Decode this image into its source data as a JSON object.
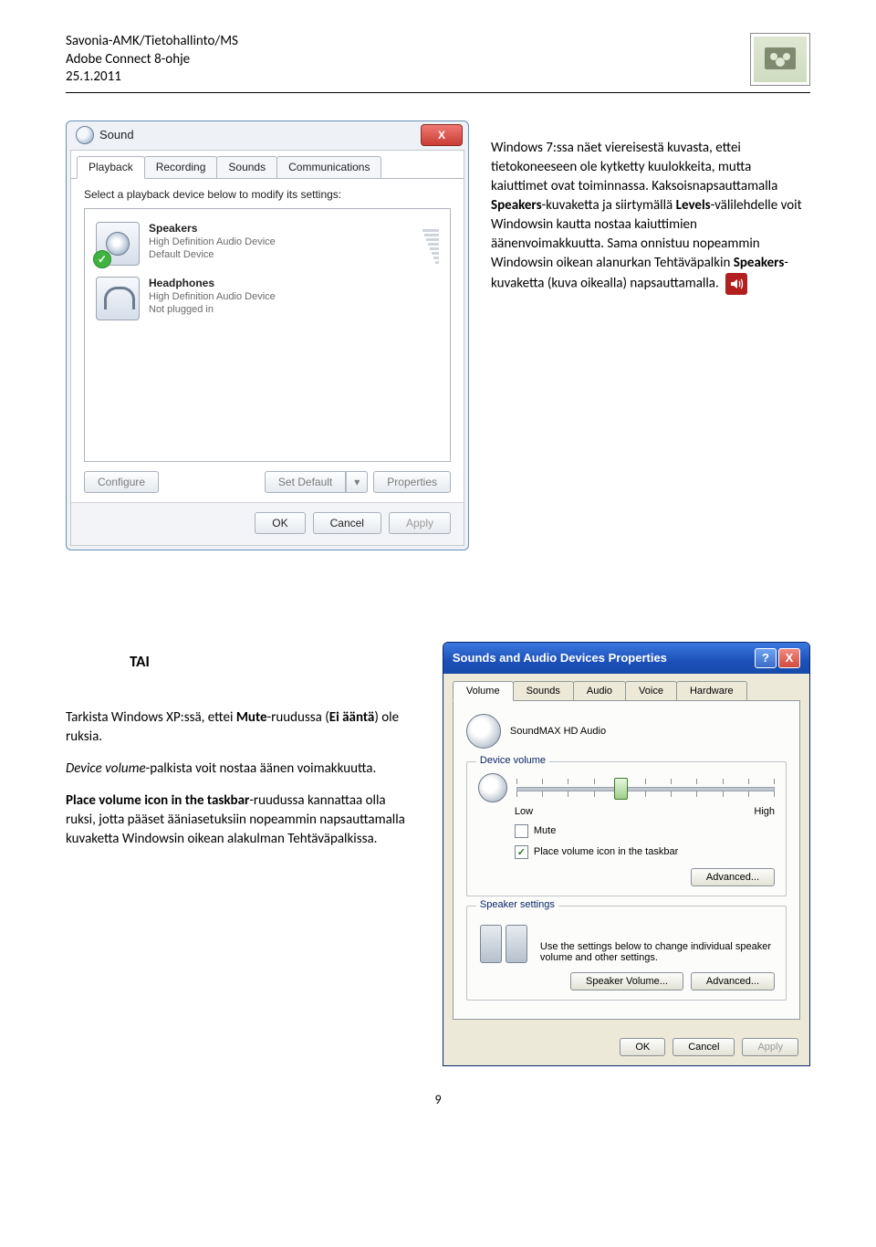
{
  "header": {
    "line1": "Savonia-AMK/Tietohallinto/MS",
    "line2": "Adobe Connect 8-ohje",
    "line3": "25.1.2011"
  },
  "win7": {
    "title": "Sound",
    "close": "X",
    "tabs": [
      "Playback",
      "Recording",
      "Sounds",
      "Communications"
    ],
    "prompt": "Select a playback device below to modify its settings:",
    "dev1": {
      "name": "Speakers",
      "l1": "High Definition Audio Device",
      "l2": "Default Device"
    },
    "dev2": {
      "name": "Headphones",
      "l1": "High Definition Audio Device",
      "l2": "Not plugged in"
    },
    "configure": "Configure",
    "setdefault": "Set Default",
    "properties": "Properties",
    "ok": "OK",
    "cancel": "Cancel",
    "apply": "Apply"
  },
  "side": {
    "p1a": "Windows 7:ssa näet viereisestä kuvasta, ettei tietokoneeseen ole kytketty kuulokkeita, mutta kaiuttimet ovat toiminnassa. Kaksoisnapsauttamalla ",
    "p1b": "Speakers",
    "p1c": "-kuvaketta ja siirtymällä ",
    "p1d": "Levels",
    "p1e": "-välilehdelle voit Windowsin kautta nostaa kaiuttimien äänenvoimakkuutta. Sama onnistuu nopeammin Windowsin oikean alanurkan Tehtäväpalkin ",
    "p1f": "Speakers",
    "p1g": "-kuvaketta (kuva oikealla) napsauttamalla."
  },
  "left": {
    "tai": "TAI",
    "p1a": "Tarkista Windows XP:ssä, ettei ",
    "p1b": "Mute",
    "p1c": "-ruudussa (",
    "p1d": "Ei ääntä",
    "p1e": ") ole ruksia.",
    "p2a": "Device volume",
    "p2b": "-palkista voit nostaa äänen voimakkuutta.",
    "p3a": "Place volume icon in the taskbar",
    "p3b": "-ruudussa kannattaa olla ruksi, jotta pääset ääniasetuksiin nopeammin napsauttamalla kuvaketta Windowsin oikean alakulman Tehtäväpalkissa."
  },
  "xp": {
    "title": "Sounds and Audio Devices Properties",
    "help": "?",
    "close": "X",
    "tabs": [
      "Volume",
      "Sounds",
      "Audio",
      "Voice",
      "Hardware"
    ],
    "device": "SoundMAX HD Audio",
    "group_vol": "Device volume",
    "low": "Low",
    "high": "High",
    "mute": "Mute",
    "taskbar": "Place volume icon in the taskbar",
    "advanced": "Advanced...",
    "group_spk": "Speaker settings",
    "spk_text": "Use the settings below to change individual speaker volume and other settings.",
    "spk_vol": "Speaker Volume...",
    "ok": "OK",
    "cancel": "Cancel",
    "apply": "Apply"
  },
  "page_number": "9"
}
